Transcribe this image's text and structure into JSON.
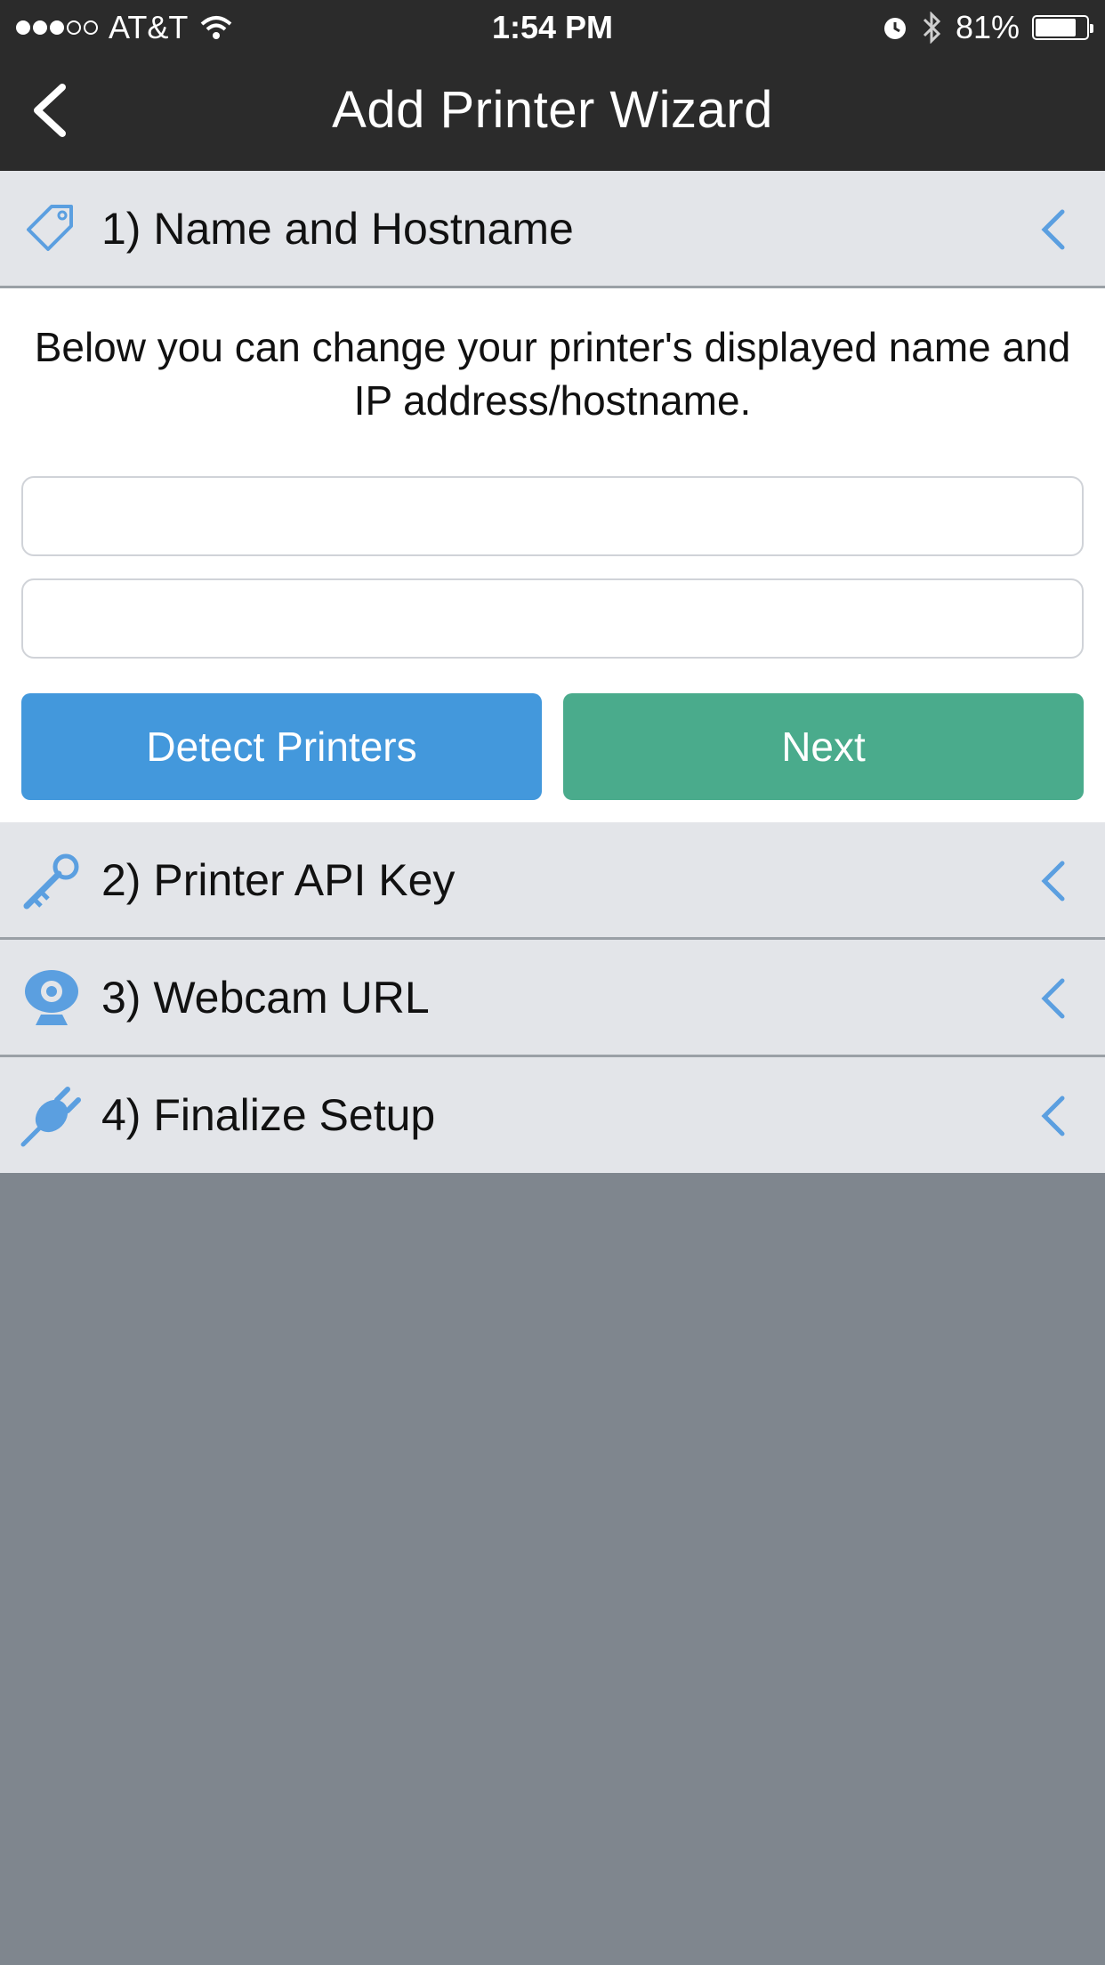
{
  "status_bar": {
    "carrier": "AT&T",
    "time": "1:54 PM",
    "battery_percent": "81%",
    "battery_level": 0.81
  },
  "nav": {
    "title": "Add Printer Wizard",
    "back_icon": "chevron-left-icon"
  },
  "sections": [
    {
      "label": "1) Name and Hostname",
      "icon": "tag-icon",
      "expanded": true
    },
    {
      "label": "2) Printer API Key",
      "icon": "key-icon",
      "expanded": false
    },
    {
      "label": "3) Webcam URL",
      "icon": "webcam-icon",
      "expanded": false
    },
    {
      "label": "4) Finalize Setup",
      "icon": "plug-icon",
      "expanded": false
    }
  ],
  "step1": {
    "description": "Below you can change your printer's displayed name and IP address/hostname.",
    "name_value": "",
    "host_value": "",
    "detect_label": "Detect Printers",
    "next_label": "Next"
  },
  "colors": {
    "accent_blue": "#4398dc",
    "accent_green": "#4aab8c",
    "icon_blue": "#5b9fe0",
    "header_bg": "#2b2b2b",
    "section_bg": "#e3e5e9",
    "backdrop": "#7f868e"
  }
}
